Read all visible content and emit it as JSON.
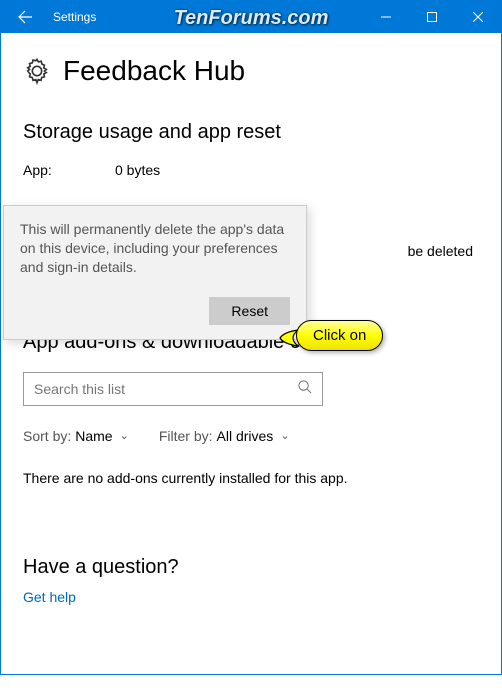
{
  "titlebar": {
    "title": "Settings"
  },
  "watermark": "TenForums.com",
  "header": {
    "app_name": "Feedback Hub"
  },
  "storage": {
    "heading": "Storage usage and app reset",
    "app_label": "App:",
    "app_value": "0 bytes",
    "reset_desc_tail": "be deleted",
    "reset_button": "Reset"
  },
  "flyout": {
    "message": "This will permanently delete the app's data on this device, including your preferences and sign-in details.",
    "confirm_button": "Reset"
  },
  "callout": {
    "text": "Click on"
  },
  "addons": {
    "heading": "App add-ons & downloadable content",
    "search_placeholder": "Search this list",
    "sort_label": "Sort by:",
    "sort_value": "Name",
    "filter_label": "Filter by:",
    "filter_value": "All drives",
    "empty": "There are no add-ons currently installed for this app."
  },
  "question": {
    "heading": "Have a question?",
    "link": "Get help"
  }
}
